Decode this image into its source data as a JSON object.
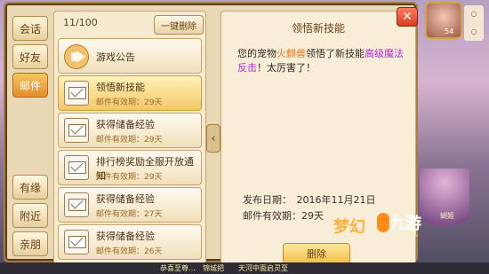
{
  "sidebar": {
    "tabs": [
      {
        "label": "会话"
      },
      {
        "label": "好友"
      },
      {
        "label": "邮件"
      },
      {
        "label": "有缘"
      },
      {
        "label": "附近"
      },
      {
        "label": "亲朋"
      }
    ]
  },
  "mailbox": {
    "count": "11/100",
    "clear_all_label": "一键删除",
    "items": [
      {
        "title": "游戏公告",
        "subtitle": ""
      },
      {
        "title": "领悟新技能",
        "subtitle": "邮件有效期：29天"
      },
      {
        "title": "获得储备经验",
        "subtitle": "邮件有效期：29天"
      },
      {
        "title": "排行榜奖励全服开放通知",
        "subtitle": "邮件有效期：29天"
      },
      {
        "title": "获得储备经验",
        "subtitle": "邮件有效期：27天"
      },
      {
        "title": "获得储备经验",
        "subtitle": "邮件有效期：26天"
      }
    ]
  },
  "detail": {
    "title": "领悟新技能",
    "body_prefix": "您的宠物",
    "pet_name": "火麒兽",
    "body_mid": "领悟了新技能",
    "skill_name": "高级魔法反击",
    "body_suffix": "！太厉害了！",
    "send_date": "发布日期：　2016年11月21日",
    "validity": "邮件有效期：29天",
    "delete_label": "删除"
  },
  "hud": {
    "level": "54",
    "status": "○\n○",
    "char_name": "蝴姬",
    "char_name2": "凡"
  },
  "logos": {
    "left": "梦幻",
    "right": "九游"
  },
  "footer": {
    "text": "恭喜至尊…　锦城把　　天河中面启灵至"
  }
}
